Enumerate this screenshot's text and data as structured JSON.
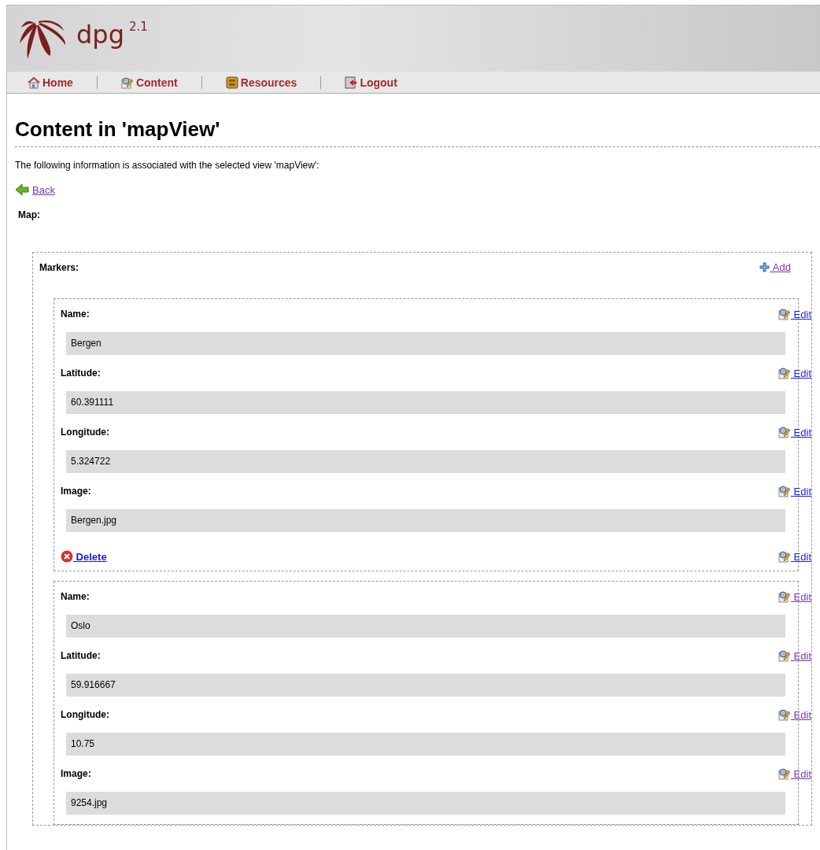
{
  "header": {
    "logo_text": "dpg",
    "version": "2.1"
  },
  "nav": [
    {
      "label": "Home",
      "kind": "home"
    },
    {
      "label": "Content",
      "kind": "edit"
    },
    {
      "label": "Resources",
      "kind": "drawer"
    },
    {
      "label": "Logout",
      "kind": "logout"
    }
  ],
  "title": "Content in 'mapView'",
  "intro": "The following information is associated with the selected view 'mapView':",
  "back_link": {
    "label": "Back",
    "visited": true
  },
  "map_label": "Map:",
  "markers": {
    "label": "Markers:",
    "add_link": {
      "label": "Add",
      "visited": true
    },
    "items": [
      {
        "fields": [
          {
            "label": "Name:",
            "value": "Bergen",
            "edit": {
              "label": "Edit",
              "visited": false
            }
          },
          {
            "label": "Latitude:",
            "value": "60.391111",
            "edit": {
              "label": "Edit",
              "visited": false
            }
          },
          {
            "label": "Longitude:",
            "value": "5.324722",
            "edit": {
              "label": "Edit",
              "visited": false
            }
          },
          {
            "label": "Image:",
            "value": "Bergen.jpg",
            "edit": {
              "label": "Edit",
              "visited": false
            }
          }
        ],
        "delete": {
          "label": "Delete",
          "visited": false
        },
        "edit": {
          "label": "Edit",
          "visited": false
        }
      },
      {
        "fields": [
          {
            "label": "Name:",
            "value": "Oslo",
            "edit": {
              "label": "Edit",
              "visited": true
            }
          },
          {
            "label": "Latitude:",
            "value": "59.916667",
            "edit": {
              "label": "Edit",
              "visited": true
            }
          },
          {
            "label": "Longitude:",
            "value": "10.75",
            "edit": {
              "label": "Edit",
              "visited": true
            }
          },
          {
            "label": "Image:",
            "value": "9254.jpg",
            "edit": {
              "label": "Edit",
              "visited": true
            }
          }
        ]
      }
    ]
  }
}
